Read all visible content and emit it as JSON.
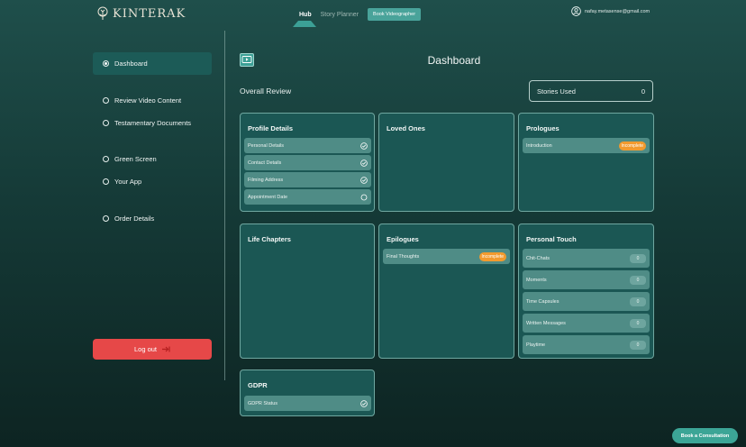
{
  "brand": {
    "name": "KINTERAK"
  },
  "nav": {
    "hub": "Hub",
    "story_planner": "Story Planner",
    "book_videographer": "Book Videographer"
  },
  "user": {
    "email": "nafay.metasense@gmail.com"
  },
  "sidebar": {
    "items": [
      {
        "label": "Dashboard",
        "active": true
      },
      {
        "label": "Review Video Content",
        "active": false
      },
      {
        "label": "Testamentary Documents",
        "active": false
      },
      {
        "label": "Green Screen",
        "active": false
      },
      {
        "label": "Your App",
        "active": false
      },
      {
        "label": "Order Details",
        "active": false
      }
    ],
    "logout": "Log out"
  },
  "main": {
    "title": "Dashboard",
    "overall_review": "Overall Review",
    "stories_used": {
      "label": "Stories Used",
      "value": "0"
    }
  },
  "cards": {
    "profile": {
      "title": "Profile Details",
      "rows": [
        {
          "label": "Personal Details",
          "status": "done"
        },
        {
          "label": "Contact Details",
          "status": "done"
        },
        {
          "label": "Filming Address",
          "status": "done"
        },
        {
          "label": "Appointment Date",
          "status": "pending"
        }
      ]
    },
    "loved_ones": {
      "title": "Loved Ones"
    },
    "prologues": {
      "title": "Prologues",
      "rows": [
        {
          "label": "Introduction",
          "badge": "Incomplete"
        }
      ]
    },
    "life_chapters": {
      "title": "Life Chapters"
    },
    "epilogues": {
      "title": "Epilogues",
      "rows": [
        {
          "label": "Final Thoughts",
          "badge": "Incomplete"
        }
      ]
    },
    "personal_touch": {
      "title": "Personal Touch",
      "rows": [
        {
          "label": "Chit-Chats",
          "count": "0"
        },
        {
          "label": "Moments",
          "count": "0"
        },
        {
          "label": "Time Capsules",
          "count": "0"
        },
        {
          "label": "Written Messages",
          "count": "0"
        },
        {
          "label": "Playtime",
          "count": "0"
        }
      ]
    },
    "gdpr": {
      "title": "GDPR",
      "rows": [
        {
          "label": "GDPR Status",
          "status": "done"
        }
      ]
    }
  },
  "footer": {
    "consultation": "Book a Consultation"
  },
  "colors": {
    "accent": "#49a39a",
    "logout": "#e64848",
    "incomplete": "#f29a2e",
    "card": "#1b5754"
  }
}
